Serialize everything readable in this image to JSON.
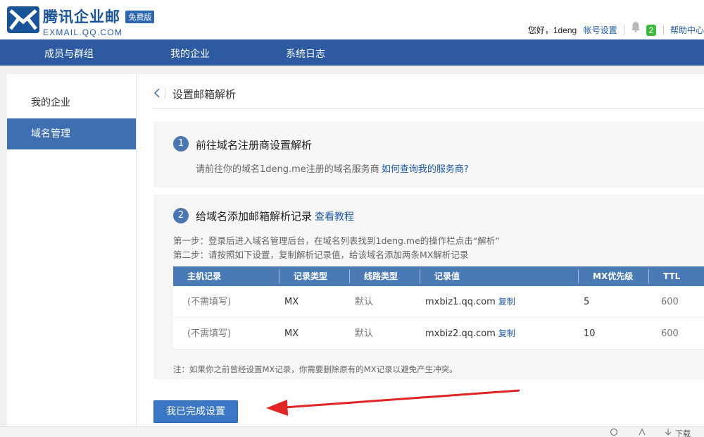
{
  "header": {
    "brand_name": "腾讯企业邮",
    "badge": "免费版",
    "brand_sub": "EXMAIL.QQ.COM",
    "greeting": "您好，1deng",
    "account_settings": "帐号设置",
    "message_count": "2",
    "help_center": "帮助中心"
  },
  "nav": {
    "items": [
      "成员与群组",
      "我的企业",
      "系统日志"
    ]
  },
  "sidebar": {
    "items": [
      "我的企业",
      "域名管理"
    ],
    "active": "域名管理"
  },
  "main": {
    "title": "设置邮箱解析",
    "step1": {
      "number": "1",
      "title": "前往域名注册商设置解析",
      "desc": "请前往你的域名1deng.me注册的域名服务商",
      "link": "如何查询我的服务商?"
    },
    "step2": {
      "number": "2",
      "title": "给域名添加邮箱解析记录",
      "link": "查看教程",
      "instr1": "第一步：登录后进入域名管理后台，在域名列表找到1deng.me的操作栏点击“解析”",
      "instr2": "第二步：请按照如下设置，复制解析记录值，给该域名添加两条MX解析记录"
    },
    "table": {
      "headers": [
        "主机记录",
        "记录类型",
        "线路类型",
        "记录值",
        "MX优先级",
        "TTL"
      ],
      "rows": [
        {
          "host": "(不需填写)",
          "type": "MX",
          "line": "默认",
          "value": "mxbiz1.qq.com",
          "copy": "复制",
          "priority": "5",
          "ttl": "600"
        },
        {
          "host": "(不需填写)",
          "type": "MX",
          "line": "默认",
          "value": "mxbiz2.qq.com",
          "copy": "复制",
          "priority": "10",
          "ttl": "600"
        }
      ]
    },
    "note": "注：如果你之前曾经设置MX记录，你需要删除原有的MX记录以避免产生冲突。",
    "done_button": "我已完成设置"
  },
  "statusbar": {
    "download": "下载"
  },
  "colors": {
    "nav_bg": "#2d5aa0",
    "sidebar_active": "#3d6fb1",
    "table_header": "#4a7ab5",
    "button": "#3a77c4",
    "arrow": "#e02525",
    "badge_green": "#3db83d"
  }
}
